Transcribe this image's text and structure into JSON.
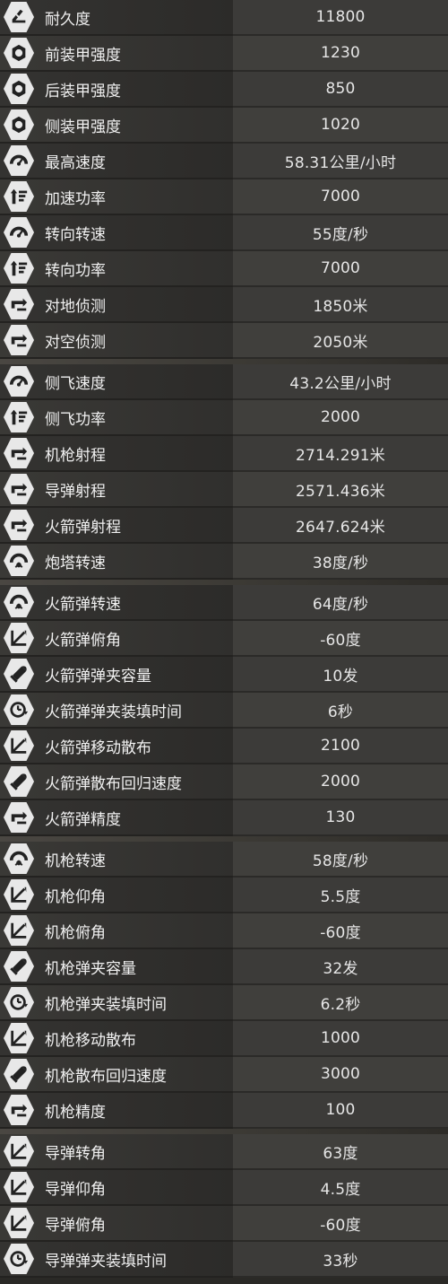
{
  "rows": [
    {
      "label": "耐久度",
      "value": "11800",
      "icon": "durability-icon"
    },
    {
      "label": "前装甲强度",
      "value": "1230",
      "icon": "armor-icon"
    },
    {
      "label": "后装甲强度",
      "value": "850",
      "icon": "armor-icon"
    },
    {
      "label": "侧装甲强度",
      "value": "1020",
      "icon": "armor-icon"
    },
    {
      "label": "最高速度",
      "value": "58.31公里/小时",
      "icon": "speedometer-icon"
    },
    {
      "label": "加速功率",
      "value": "7000",
      "icon": "power-icon"
    },
    {
      "label": "转向转速",
      "value": "55度/秒",
      "icon": "speedometer-icon"
    },
    {
      "label": "转向功率",
      "value": "7000",
      "icon": "power-icon"
    },
    {
      "label": "对地侦测",
      "value": "1850米",
      "icon": "range-icon"
    },
    {
      "label": "对空侦测",
      "value": "2050米",
      "icon": "range-icon"
    },
    {
      "label": "侧飞速度",
      "value": "43.2公里/小时",
      "icon": "speedometer-icon",
      "gap": true
    },
    {
      "label": "侧飞功率",
      "value": "2000",
      "icon": "power-icon"
    },
    {
      "label": "机枪射程",
      "value": "2714.291米",
      "icon": "range-icon"
    },
    {
      "label": "导弹射程",
      "value": "2571.436米",
      "icon": "range-icon"
    },
    {
      "label": "火箭弹射程",
      "value": "2647.624米",
      "icon": "range-icon"
    },
    {
      "label": "炮塔转速",
      "value": "38度/秒",
      "icon": "turret-rotation-icon"
    },
    {
      "label": "火箭弹转速",
      "value": "64度/秒",
      "icon": "turret-rotation-icon",
      "gap": true
    },
    {
      "label": "火箭弹俯角",
      "value": "-60度",
      "icon": "angle-icon"
    },
    {
      "label": "火箭弹弹夹容量",
      "value": "10发",
      "icon": "ammo-icon"
    },
    {
      "label": "火箭弹弹夹装填时间",
      "value": "6秒",
      "icon": "reload-timer-icon"
    },
    {
      "label": "火箭弹移动散布",
      "value": "2100",
      "icon": "angle-icon"
    },
    {
      "label": "火箭弹散布回归速度",
      "value": "2000",
      "icon": "ammo-icon"
    },
    {
      "label": "火箭弹精度",
      "value": "130",
      "icon": "range-icon"
    },
    {
      "label": "机枪转速",
      "value": "58度/秒",
      "icon": "turret-rotation-icon",
      "gap": true
    },
    {
      "label": "机枪仰角",
      "value": "5.5度",
      "icon": "angle-icon"
    },
    {
      "label": "机枪俯角",
      "value": "-60度",
      "icon": "angle-icon"
    },
    {
      "label": "机枪弹夹容量",
      "value": "32发",
      "icon": "ammo-icon"
    },
    {
      "label": "机枪弹夹装填时间",
      "value": "6.2秒",
      "icon": "reload-timer-icon"
    },
    {
      "label": "机枪移动散布",
      "value": "1000",
      "icon": "angle-icon"
    },
    {
      "label": "机枪散布回归速度",
      "value": "3000",
      "icon": "ammo-icon"
    },
    {
      "label": "机枪精度",
      "value": "100",
      "icon": "range-icon"
    },
    {
      "label": "导弹转角",
      "value": "63度",
      "icon": "angle-icon",
      "gap": true
    },
    {
      "label": "导弹仰角",
      "value": "4.5度",
      "icon": "angle-icon"
    },
    {
      "label": "导弹俯角",
      "value": "-60度",
      "icon": "angle-icon"
    },
    {
      "label": "导弹弹夹装填时间",
      "value": "33秒",
      "icon": "reload-timer-icon"
    }
  ]
}
